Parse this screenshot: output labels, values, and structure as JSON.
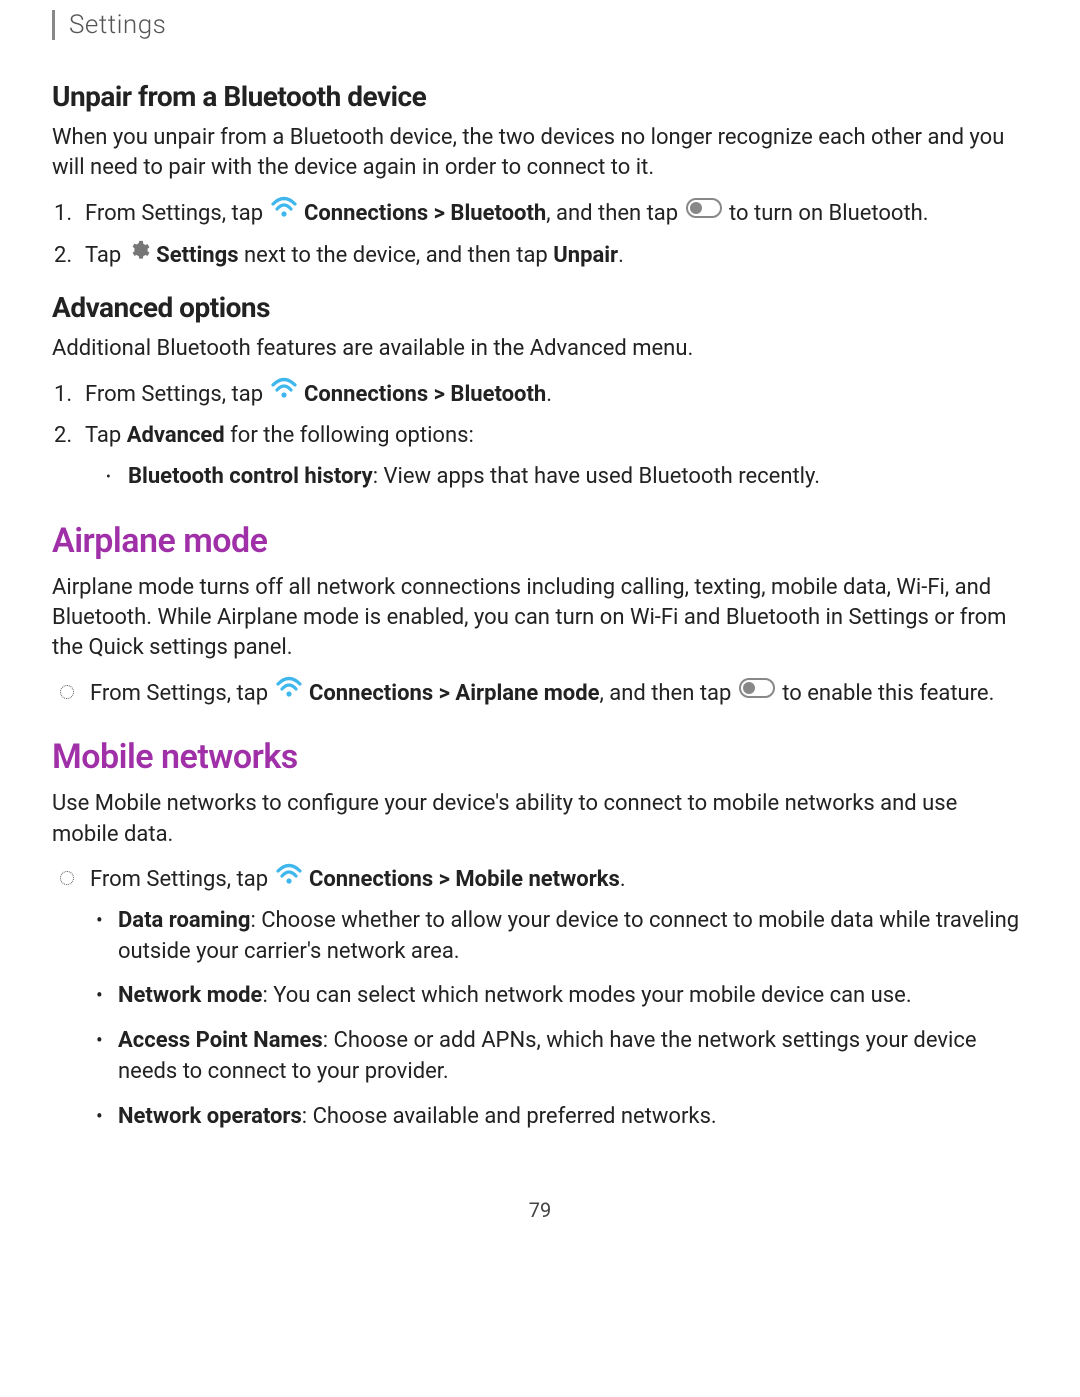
{
  "header": {
    "title": "Settings"
  },
  "sections": {
    "unpair": {
      "heading": "Unpair from a Bluetooth device",
      "intro": "When you unpair from a Bluetooth device, the two devices no longer recognize each other and you will need to pair with the device again in order to connect to it.",
      "step1_pre": "From Settings, tap ",
      "step1_link": "Connections > Bluetooth",
      "step1_mid": ", and then tap ",
      "step1_end": " to turn on Bluetooth.",
      "step2_pre": "Tap ",
      "step2_settings": "Settings",
      "step2_mid": " next to the device, and then tap ",
      "step2_unpair": "Unpair",
      "step2_end": "."
    },
    "advanced": {
      "heading": "Advanced options",
      "intro": "Additional Bluetooth features are available in the Advanced menu.",
      "step1_pre": "From Settings, tap ",
      "step1_link": "Connections > Bluetooth",
      "step1_end": ".",
      "step2_pre": "Tap ",
      "step2_adv": "Advanced",
      "step2_mid": " for the following options:",
      "bullet_label": "Bluetooth control history",
      "bullet_text": ": View apps that have used Bluetooth recently."
    },
    "airplane": {
      "heading": "Airplane mode",
      "intro": "Airplane mode turns off all network connections including calling, texting, mobile data, Wi-Fi, and Bluetooth. While Airplane mode is enabled, you can turn on Wi-Fi and Bluetooth in Settings or from the Quick settings panel.",
      "bullet_pre": "From Settings, tap ",
      "bullet_link": "Connections > Airplane mode",
      "bullet_mid": ", and then tap ",
      "bullet_end": " to enable this feature."
    },
    "mobile": {
      "heading": "Mobile networks",
      "intro": "Use Mobile networks to configure your device's ability to connect to mobile networks and use mobile data.",
      "bullet_pre": "From Settings, tap ",
      "bullet_link": "Connections > Mobile networks",
      "bullet_end": ".",
      "items": {
        "roaming_label": "Data roaming",
        "roaming_text": ": Choose whether to allow your device to connect to mobile data while traveling outside your carrier's network area.",
        "mode_label": "Network mode",
        "mode_text": ": You can select which network modes your mobile device can use.",
        "apn_label": "Access Point Names",
        "apn_text": ": Choose or add APNs, which have the network settings your device needs to connect to your provider.",
        "operators_label": "Network operators",
        "operators_text": ": Choose available and preferred networks."
      }
    }
  },
  "page_number": "79"
}
